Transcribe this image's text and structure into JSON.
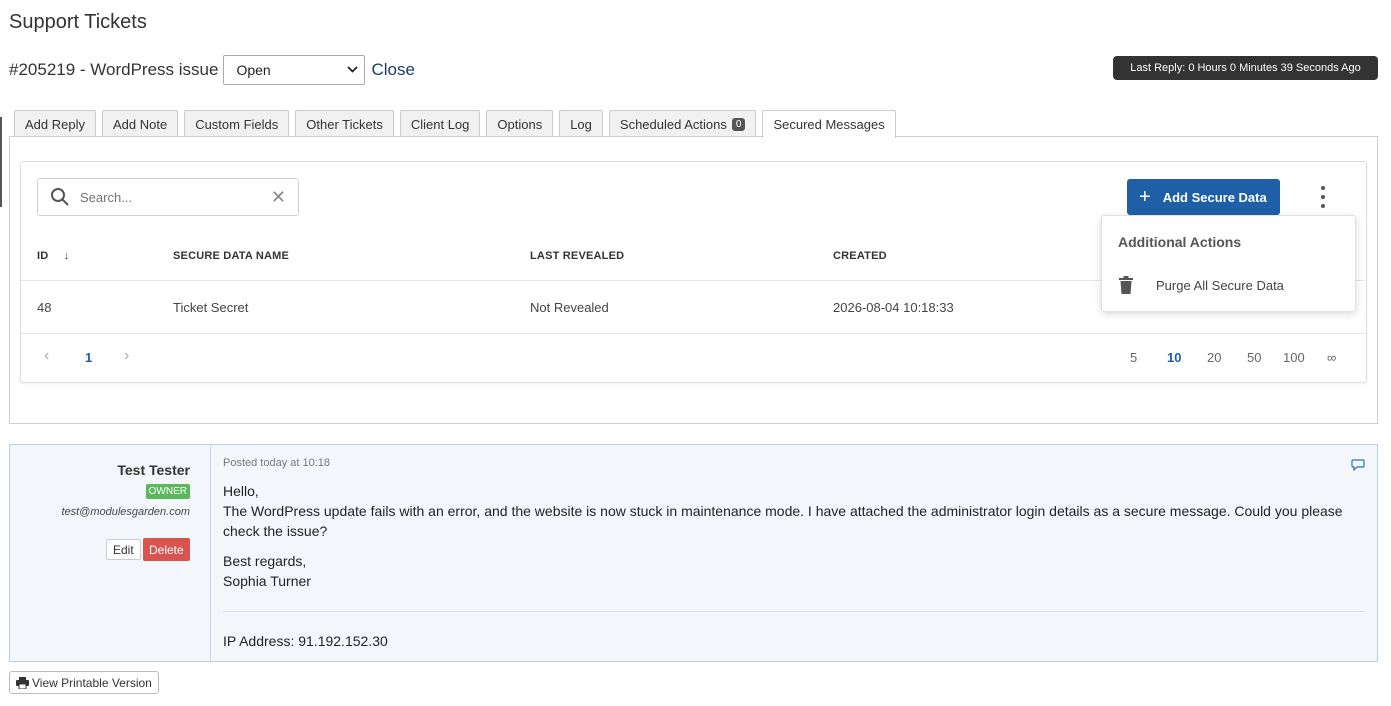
{
  "page": {
    "title": "Support Tickets"
  },
  "ticket": {
    "heading": "#205219 - WordPress issue",
    "status": "Open",
    "close_label": "Close",
    "last_reply": "Last Reply: 0 Hours 0 Minutes 39 Seconds Ago"
  },
  "tabs": [
    {
      "label": "Add Reply"
    },
    {
      "label": "Add Note"
    },
    {
      "label": "Custom Fields"
    },
    {
      "label": "Other Tickets"
    },
    {
      "label": "Client Log"
    },
    {
      "label": "Options"
    },
    {
      "label": "Log"
    },
    {
      "label": "Scheduled Actions",
      "badge": "0"
    },
    {
      "label": "Secured Messages",
      "active": true
    }
  ],
  "secure": {
    "search_placeholder": "Search...",
    "add_button": "Add Secure Data",
    "columns": {
      "id": "ID",
      "sort_arrow": "↓",
      "name": "SECURE DATA NAME",
      "last_revealed": "LAST REVEALED",
      "created": "CREATED"
    },
    "rows": [
      {
        "id": "48",
        "name": "Ticket Secret",
        "last_revealed": "Not Revealed",
        "created": "2026-08-04 10:18:33"
      }
    ],
    "pagination": {
      "prev": "‹",
      "current": "1",
      "next": "›"
    },
    "page_sizes": [
      "5",
      "10",
      "20",
      "50",
      "100",
      "∞"
    ],
    "active_page_size": "10",
    "dropdown": {
      "title": "Additional Actions",
      "item": "Purge All Secure Data"
    }
  },
  "reply": {
    "author": "Test Tester",
    "role": "OWNER",
    "email": "test@modulesgarden.com",
    "edit": "Edit",
    "delete": "Delete",
    "posted": "Posted today at 10:18",
    "lines": [
      "Hello,",
      "The WordPress update fails with an error, and the website is now stuck in maintenance mode. I have attached the administrator login details as a secure message. Could you please check the issue?",
      "Best regards,",
      "Sophia Turner"
    ],
    "ip": "IP Address: 91.192.152.30"
  },
  "print_label": "View Printable Version",
  "colors": {
    "primary": "#1f5fa8",
    "owner_badge": "#5cb85c",
    "delete": "#d9534f",
    "last_reply_bg": "#333333",
    "reply_bg": "#f3f7fb"
  }
}
